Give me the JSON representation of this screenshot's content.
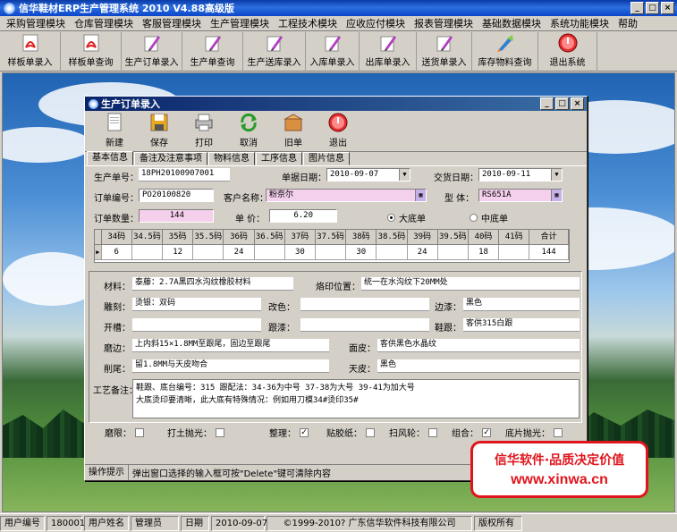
{
  "app": {
    "title": "信华鞋材ERP生产管理系统   2010  V4.88高级版"
  },
  "menu": [
    "采购管理模块",
    "仓库管理模块",
    "客服管理模块",
    "生产管理模块",
    "工程技术模块",
    "应收应付模块",
    "报表管理模块",
    "基础数据模块",
    "系统功能模块",
    "帮助"
  ],
  "toolbar": [
    {
      "label": "样板单录入",
      "icon": "acrobat-doc-icon",
      "w": 68
    },
    {
      "label": "样板单查询",
      "icon": "acrobat-doc-icon",
      "w": 68
    },
    {
      "label": "生产订单录入",
      "icon": "pen-doc-icon",
      "w": 68
    },
    {
      "label": "生产单查询",
      "icon": "pen-doc-icon",
      "w": 68
    },
    {
      "label": "生产送库录入",
      "icon": "pen-doc-icon",
      "w": 70
    },
    {
      "label": "入库单录入",
      "icon": "pen-doc-icon",
      "w": 60
    },
    {
      "label": "出库单录入",
      "icon": "pen-doc-icon",
      "w": 64
    },
    {
      "label": "送货单录入",
      "icon": "pen-doc-icon",
      "w": 62
    },
    {
      "label": "库存物料查询",
      "icon": "rocket-icon",
      "w": 74
    },
    {
      "label": "退出系统",
      "icon": "exit-icon",
      "w": 66
    }
  ],
  "dialog": {
    "title": "生产订单录入",
    "tools": [
      "新建",
      "保存",
      "打印",
      "取消",
      "旧单",
      "退出"
    ],
    "tabs": [
      "基本信息",
      "备注及注意事项",
      "物料信息",
      "工序信息",
      "图片信息"
    ],
    "fields": {
      "prod_no_label": "生产单号：",
      "prod_no": "18PH20100907001",
      "order_date_label": "单据日期：",
      "order_date": "2010-09-07",
      "delivery_label": "交货日期：",
      "delivery": "2010-09-11",
      "order_no_label": "订单编号：",
      "order_no": "PO20100820",
      "customer_label": "客户名称：",
      "customer": "粉奈尔",
      "model_label": "型  体：",
      "model": "RS651A",
      "qty_label": "订单数量：",
      "qty": "144",
      "price_label": "单  价：",
      "price": "6.20",
      "radio1": "大底单",
      "radio2": "中底单"
    },
    "grid": {
      "headers": [
        "34码",
        "34.5码",
        "35码",
        "35.5码",
        "36码",
        "36.5码",
        "37码",
        "37.5码",
        "38码",
        "38.5码",
        "39码",
        "39.5码",
        "40码",
        "41码",
        "合计"
      ],
      "row": [
        "6",
        "",
        "12",
        "",
        "24",
        "",
        "30",
        "",
        "30",
        "",
        "24",
        "",
        "18",
        "",
        "144"
      ]
    },
    "detail": {
      "material_label": "材料：",
      "material": "泰藤：2.7A黑四水沟纹橡胶材料",
      "print_label": "烙印位置：",
      "print": "统一在水沟纹下20MM处",
      "carve_label": "雕刻：",
      "carve": "烫银：双码",
      "color_label": "改色：",
      "color": "",
      "edge_label": "边漆：",
      "edge": "黑色",
      "slot_label": "开槽：",
      "slot": "",
      "heel_paint_label": "跟漆：",
      "heel_paint": "",
      "heel_label": "鞋跟：",
      "heel": "客供315白跟",
      "edge_grind_label": "磨边：",
      "edge_grind": "上内斜15×1.8MM至跟尾，固边至跟尾",
      "surface_label": "面皮：",
      "surface": "客供黑色水晶纹",
      "trim_label": "削尾：",
      "trim": "留1.8MM与天皮吻合",
      "top_label": "天皮：",
      "top": "黑色",
      "remarks_label": "工艺备注：",
      "remarks_line1": "鞋跟、底台编号：315  跟配法：34-36为中号     37-38为大号      39-41为加大号",
      "remarks_line2": "大底烫印要清晰，此大底有特殊情况：例如用刀模34#烫印35#"
    },
    "checks": [
      {
        "label": "磨限：",
        "checked": false
      },
      {
        "label": "打土抛光：",
        "checked": false
      },
      {
        "label": "整理：",
        "checked": true
      },
      {
        "label": "贴胶纸：",
        "checked": false
      },
      {
        "label": "扫风轮：",
        "checked": false
      },
      {
        "label": "组合：",
        "checked": true
      },
      {
        "label": "底片抛光：",
        "checked": false
      }
    ],
    "status_tip": "操作提示",
    "status_msg": "弹出窗口选择的输入框可按\"Delete\"键可清除内容"
  },
  "promo": {
    "line1": "信华软件·品质决定价值",
    "line2": "www.xinwa.cn"
  },
  "statusbar": {
    "user_no_label": "用户编号",
    "user_no": "180001",
    "user_name_label": "用户姓名",
    "user_name": "管理员",
    "date_label": "日期",
    "date": "2010-09-07",
    "copyright": "©1999-2010?  广东信华软件科技有限公司",
    "rights": "版权所有"
  }
}
